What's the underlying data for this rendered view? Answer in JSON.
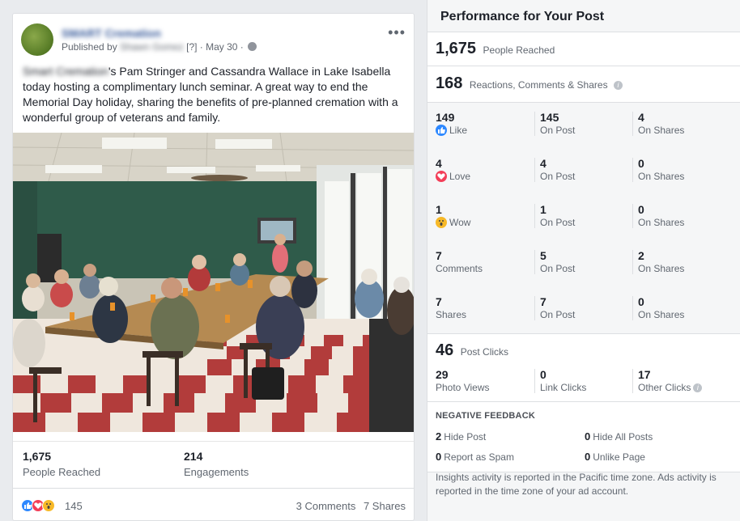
{
  "post": {
    "page_name": "SMART Cremation",
    "published_prefix": "Published by",
    "published_by": "Shawn Gomez",
    "published_meta": "[?] · May 30 ·",
    "text_page_name": "Smart Cremation",
    "text_body": "'s Pam Stringer and Cassandra Wallace in Lake Isabella today hosting a complimentary lunch seminar. A great way to end the Memorial Day holiday, sharing the benefits of pre-planned cremation with a wonderful group of veterans and family.",
    "more_icon": "more-horizontal-icon",
    "metrics": [
      {
        "value": "1,675",
        "label": "People Reached"
      },
      {
        "value": "214",
        "label": "Engagements"
      }
    ],
    "reactions_count": "145",
    "comments": "3 Comments",
    "shares": "7 Shares"
  },
  "insights": {
    "title": "Performance for Your Post",
    "reach": {
      "value": "1,675",
      "label": "People Reached"
    },
    "rcs": {
      "value": "168",
      "label": "Reactions, Comments & Shares"
    },
    "breakdown": [
      {
        "total": "149",
        "label": "Like",
        "icon": "like-icon",
        "on_post": "145",
        "on_post_label": "On Post",
        "on_shares": "4",
        "on_shares_label": "On Shares"
      },
      {
        "total": "4",
        "label": "Love",
        "icon": "love-icon",
        "on_post": "4",
        "on_post_label": "On Post",
        "on_shares": "0",
        "on_shares_label": "On Shares"
      },
      {
        "total": "1",
        "label": "Wow",
        "icon": "wow-icon",
        "on_post": "1",
        "on_post_label": "On Post",
        "on_shares": "0",
        "on_shares_label": "On Shares"
      },
      {
        "total": "7",
        "label": "Comments",
        "on_post": "5",
        "on_post_label": "On Post",
        "on_shares": "2",
        "on_shares_label": "On Shares"
      },
      {
        "total": "7",
        "label": "Shares",
        "on_post": "7",
        "on_post_label": "On Post",
        "on_shares": "0",
        "on_shares_label": "On Shares"
      }
    ],
    "clicks": {
      "value": "46",
      "label": "Post Clicks",
      "photo_views": "29",
      "photo_views_label": "Photo Views",
      "link_clicks": "0",
      "link_clicks_label": "Link Clicks",
      "other_clicks": "17",
      "other_clicks_label": "Other Clicks"
    },
    "negative": {
      "title": "NEGATIVE FEEDBACK",
      "hide_post": "2",
      "hide_post_label": "Hide Post",
      "hide_all": "0",
      "hide_all_label": "Hide All Posts",
      "spam": "0",
      "spam_label": "Report as Spam",
      "unlike": "0",
      "unlike_label": "Unlike Page"
    },
    "footnote": "Insights activity is reported in the Pacific time zone. Ads activity is reported in the time zone of your ad account."
  }
}
